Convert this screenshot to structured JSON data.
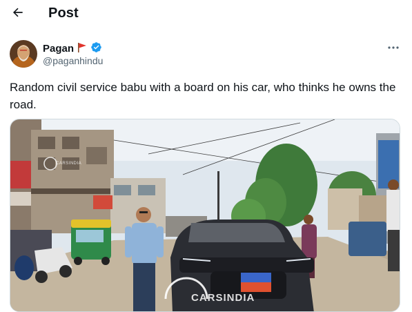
{
  "header": {
    "title": "Post",
    "back_icon": "arrow-left-icon"
  },
  "author": {
    "display_name": "Pagan",
    "handle": "@paganhindu",
    "flag_icon": "red-flag-icon",
    "verified_icon": "verified-badge-icon",
    "verified_color": "#1d9bf0"
  },
  "post": {
    "text": "Random civil service babu with a board on his car, who thinks he owns the road.",
    "more_icon": "more-dots-icon"
  },
  "media": {
    "watermark": "CARSINDIA",
    "watermark_small": "CARSINDIA"
  },
  "colors": {
    "text_primary": "#0f1419",
    "text_secondary": "#536471",
    "border": "#cfd9de"
  }
}
